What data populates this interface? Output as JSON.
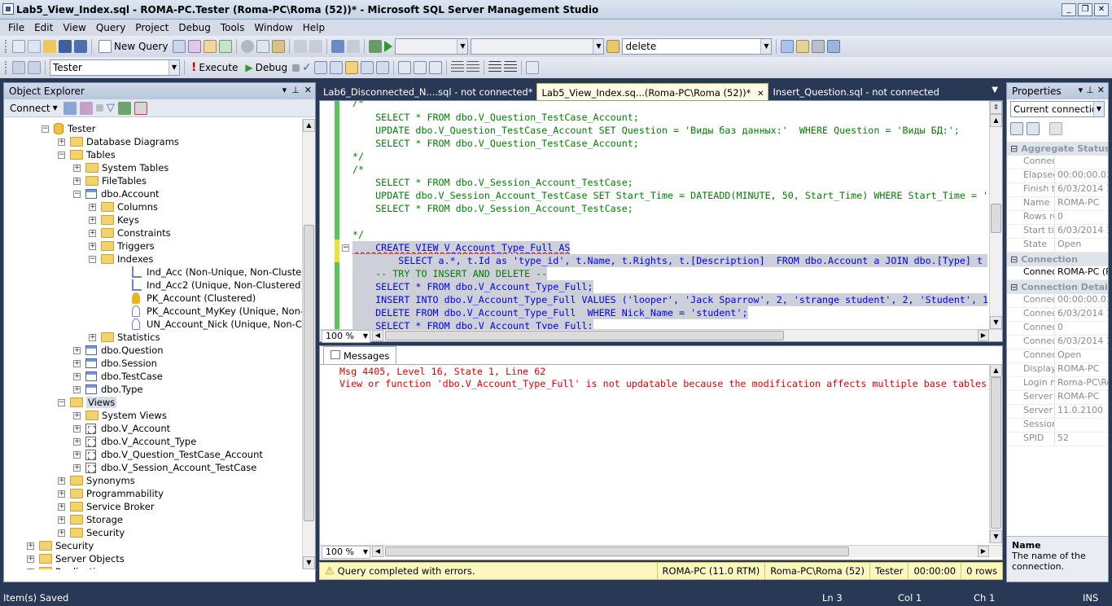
{
  "window": {
    "title": "Lab5_View_Index.sql - ROMA-PC.Tester (Roma-PC\\Roma (52))* - Microsoft SQL Server Management Studio"
  },
  "menu": [
    "File",
    "Edit",
    "View",
    "Query",
    "Project",
    "Debug",
    "Tools",
    "Window",
    "Help"
  ],
  "toolbar": {
    "new_query": "New Query",
    "search_value": "delete"
  },
  "toolbar2": {
    "database": "Tester",
    "execute": "Execute",
    "debug": "Debug"
  },
  "object_explorer": {
    "title": "Object Explorer",
    "connect": "Connect",
    "nodes": [
      {
        "label": "Tester",
        "exp": "−"
      },
      {
        "label": "Database Diagrams",
        "exp": "+"
      },
      {
        "label": "Tables",
        "exp": "−"
      },
      {
        "label": "System Tables",
        "exp": "+"
      },
      {
        "label": "FileTables",
        "exp": "+"
      },
      {
        "label": "dbo.Account",
        "exp": "−"
      },
      {
        "label": "Columns",
        "exp": "+"
      },
      {
        "label": "Keys",
        "exp": "+"
      },
      {
        "label": "Constraints",
        "exp": "+"
      },
      {
        "label": "Triggers",
        "exp": "+"
      },
      {
        "label": "Indexes",
        "exp": "−"
      },
      {
        "label": "Ind_Acc (Non-Unique, Non-Clustered)",
        "exp": ""
      },
      {
        "label": "Ind_Acc2 (Unique, Non-Clustered)",
        "exp": ""
      },
      {
        "label": "PK_Account (Clustered)",
        "exp": ""
      },
      {
        "label": "PK_Account_MyKey (Unique, Non-Clustere",
        "exp": ""
      },
      {
        "label": "UN_Account_Nick (Unique, Non-Clustered)",
        "exp": ""
      },
      {
        "label": "Statistics",
        "exp": "+"
      },
      {
        "label": "dbo.Question",
        "exp": "+"
      },
      {
        "label": "dbo.Session",
        "exp": "+"
      },
      {
        "label": "dbo.TestCase",
        "exp": "+"
      },
      {
        "label": "dbo.Type",
        "exp": "+"
      },
      {
        "label": "Views",
        "exp": "−"
      },
      {
        "label": "System Views",
        "exp": "+"
      },
      {
        "label": "dbo.V_Account",
        "exp": "+"
      },
      {
        "label": "dbo.V_Account_Type",
        "exp": "+"
      },
      {
        "label": "dbo.V_Question_TestCase_Account",
        "exp": "+"
      },
      {
        "label": "dbo.V_Session_Account_TestCase",
        "exp": "+"
      },
      {
        "label": "Synonyms",
        "exp": "+"
      },
      {
        "label": "Programmability",
        "exp": "+"
      },
      {
        "label": "Service Broker",
        "exp": "+"
      },
      {
        "label": "Storage",
        "exp": "+"
      },
      {
        "label": "Security",
        "exp": "+"
      },
      {
        "label": "Security",
        "exp": "+"
      },
      {
        "label": "Server Objects",
        "exp": "+"
      },
      {
        "label": "Replication",
        "exp": "+"
      }
    ]
  },
  "tabs": [
    {
      "label": "Lab6_Disconnected_N....sql - not connected*"
    },
    {
      "label": "Lab5_View_Index.sq...(Roma-PC\\Roma (52))*",
      "close": "✕"
    },
    {
      "label": "Insert_Question.sql - not connected"
    }
  ],
  "editor": {
    "zoom": "100 %",
    "lines": [
      "/*",
      "    SELECT * FROM dbo.V_Question_TestCase_Account;",
      "    UPDATE dbo.V_Question_TestCase_Account SET Question = 'Виды баз данных:'  WHERE Question = 'Виды БД:';",
      "    SELECT * FROM dbo.V_Question_TestCase_Account;",
      "",
      "*/",
      "/*",
      "",
      "    SELECT * FROM dbo.V_Session_Account_TestCase;",
      "    UPDATE dbo.V_Session_Account_TestCase SET Start_Time = DATEADD(MINUTE, 50, Start_Time) WHERE Start_Time = '20",
      "    SELECT * FROM dbo.V_Session_Account_TestCase;",
      "",
      "*/",
      "    CREATE VIEW V_Account_Type_Full AS",
      "        SELECT a.*, t.Id as 'type_id', t.Name, t.Rights, t.[Description]  FROM dbo.Account a JOIN dbo.[Type] t ON",
      "    -- TRY TO INSERT AND DELETE --",
      "    SELECT * FROM dbo.V_Account_Type_Full;",
      "    INSERT INTO dbo.V_Account_Type_Full VALUES ('looper', 'Jack Sparrow', 2, 'strange student', 2, 'Student', 1,",
      "    DELETE FROM dbo.V_Account_Type_Full  WHERE Nick_Name = 'student';",
      "    SELECT * FROM dbo.V_Account_Type_Full;"
    ]
  },
  "messages": {
    "tab": "Messages",
    "zoom": "100 %",
    "line1": "Msg 4405, Level 16, State 1, Line 62",
    "line2": "View or function 'dbo.V_Account_Type_Full' is not updatable because the modification affects multiple base tables."
  },
  "query_status": {
    "text": "Query completed with errors.",
    "server": "ROMA-PC (11.0 RTM)",
    "login": "Roma-PC\\Roma (52)",
    "db": "Tester",
    "time": "00:00:00",
    "rows": "0 rows"
  },
  "properties": {
    "title": "Properties",
    "object": "Current connection",
    "cat1": "Aggregate Status",
    "rows1": [
      {
        "k": "Connect",
        "v": ""
      },
      {
        "k": "Elapsed",
        "v": "00:00:00.03"
      },
      {
        "k": "Finish tir",
        "v": "6/03/2014 1"
      },
      {
        "k": "Name",
        "v": "ROMA-PC"
      },
      {
        "k": "Rows re",
        "v": "0"
      },
      {
        "k": "Start tim",
        "v": "6/03/2014 1"
      },
      {
        "k": "State",
        "v": "Open"
      }
    ],
    "cat2": "Connection",
    "rows2": [
      {
        "k": "Connect",
        "v": "ROMA-PC (R"
      }
    ],
    "cat3": "Connection Details",
    "rows3": [
      {
        "k": "Connect",
        "v": "00:00:00.03"
      },
      {
        "k": "Connect",
        "v": "6/03/2014 1"
      },
      {
        "k": "Connect",
        "v": "0"
      },
      {
        "k": "Connect",
        "v": "6/03/2014 1"
      },
      {
        "k": "Connect",
        "v": "Open"
      },
      {
        "k": "Display n",
        "v": "ROMA-PC"
      },
      {
        "k": "Login na",
        "v": "Roma-PC\\Ro"
      },
      {
        "k": "Server n",
        "v": "ROMA-PC"
      },
      {
        "k": "Server v",
        "v": "11.0.2100"
      },
      {
        "k": "Session",
        "v": ""
      },
      {
        "k": "SPID",
        "v": "52"
      }
    ],
    "desc_title": "Name",
    "desc_text": "The name of the connection."
  },
  "statusbar": {
    "left": "Item(s) Saved",
    "ln": "Ln 3",
    "col": "Col 1",
    "ch": "Ch 1",
    "ins": "INS"
  }
}
